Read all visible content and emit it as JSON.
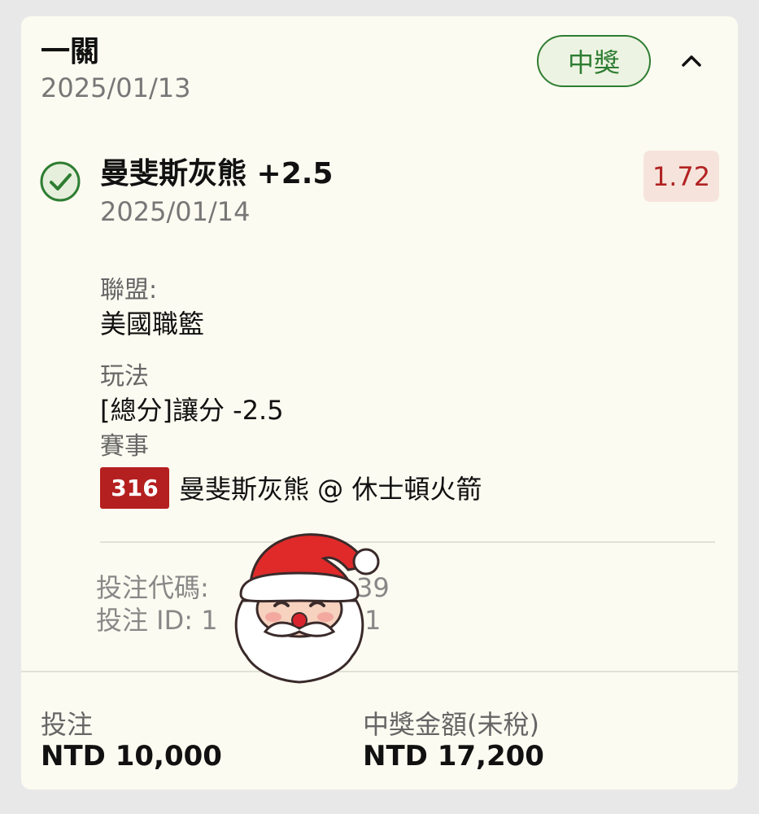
{
  "header": {
    "title": "一關",
    "date": "2025/01/13",
    "status": "中獎",
    "collapse_icon": "chevron-up-icon"
  },
  "selection": {
    "status_icon": "check-circle-icon",
    "title": "曼斐斯灰熊 +2.5",
    "date": "2025/01/14",
    "odds": "1.72",
    "league_label": "聯盟:",
    "league_value": "美國職籃",
    "market_label": "玩法",
    "market_value": "[總分]讓分 -2.5",
    "event_label": "賽事",
    "event_code": "316",
    "event_name": "曼斐斯灰熊 @ 休士頓火箭"
  },
  "meta": {
    "bet_code": "投注代碼:",
    "bet_code_tail": "39",
    "bet_id": "投注 ID: 1",
    "bet_id_tail": "1"
  },
  "footer": {
    "stake_label": "投注",
    "stake_value": "NTD 10,000",
    "payout_label": "中獎金額(未稅)",
    "payout_value": "NTD 17,200"
  },
  "colors": {
    "card_bg": "#fcfbf1",
    "win_green": "#2e7d32",
    "odds_red": "#b22222",
    "badge_red": "#b41f1f"
  },
  "overlay_icon": "santa-claus-sticker"
}
